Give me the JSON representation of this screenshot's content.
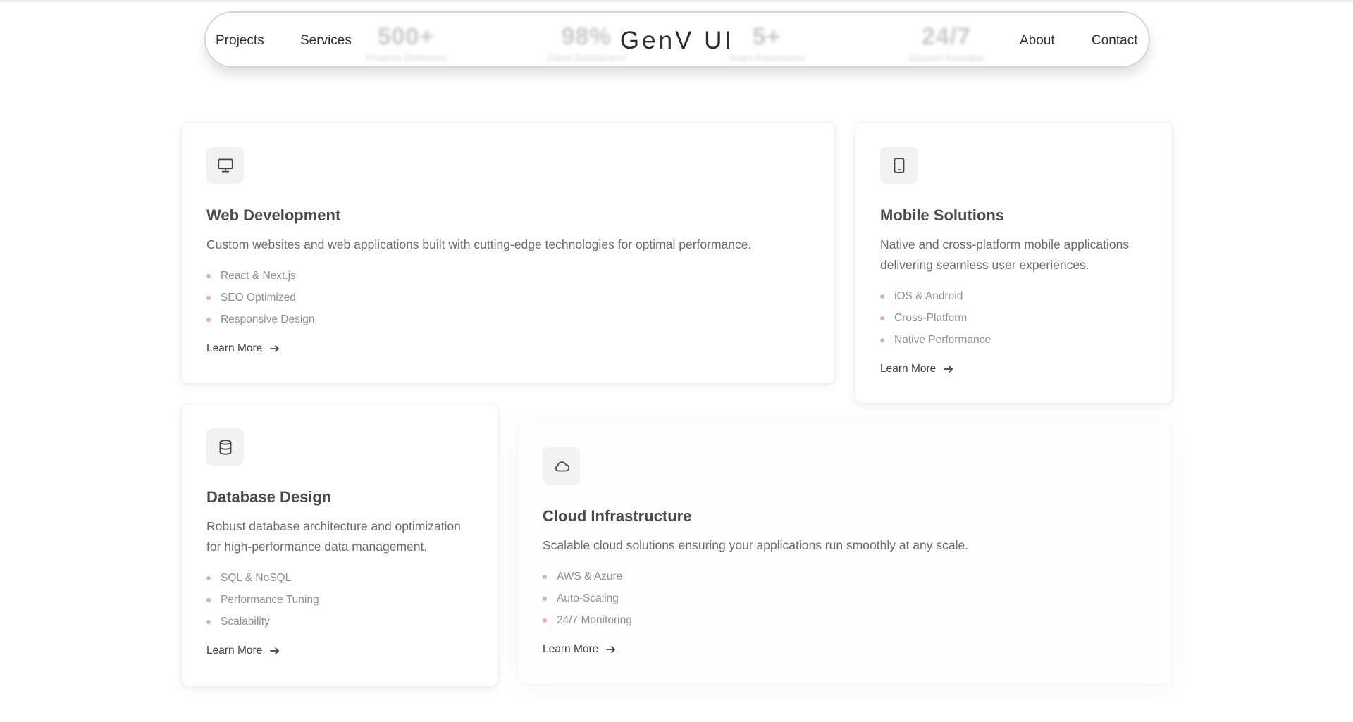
{
  "stats": [
    {
      "value": "500+",
      "label": "Projects Delivered"
    },
    {
      "value": "98%",
      "label": "Client Satisfaction"
    },
    {
      "value": "5+",
      "label": "Years Experience"
    },
    {
      "value": "24/7",
      "label": "Support Available"
    }
  ],
  "nav": {
    "links_left": [
      "Projects",
      "Services"
    ],
    "logo": "GenV UI",
    "links_right": [
      "About",
      "Contact"
    ]
  },
  "cards": [
    {
      "icon": "monitor-icon",
      "title": "Web Development",
      "description": "Custom websites and web applications built with cutting-edge technologies for optimal performance.",
      "features": [
        "React & Next.js",
        "SEO Optimized",
        "Responsive Design"
      ],
      "cta": "Learn More"
    },
    {
      "icon": "tablet-icon",
      "title": "Mobile Solutions",
      "description": "Native and cross-platform mobile applications delivering seamless user experiences.",
      "features": [
        "iOS & Android",
        "Cross-Platform",
        "Native Performance"
      ],
      "cta": "Learn More"
    },
    {
      "icon": "database-icon",
      "title": "Database Design",
      "description": "Robust database architecture and optimization for high-performance data management.",
      "features": [
        "SQL & NoSQL",
        "Performance Tuning",
        "Scalability"
      ],
      "cta": "Learn More"
    },
    {
      "icon": "cloud-icon",
      "title": "Cloud Infrastructure",
      "description": "Scalable cloud solutions ensuring your applications run smoothly at any scale.",
      "features": [
        "AWS & Azure",
        "Auto-Scaling",
        "24/7 Monitoring"
      ],
      "cta": "Learn More"
    }
  ],
  "colors": {
    "bullet": "#e0b0a4",
    "text_primary": "#4a4a50",
    "icon_bg": "#f2f2f3"
  }
}
